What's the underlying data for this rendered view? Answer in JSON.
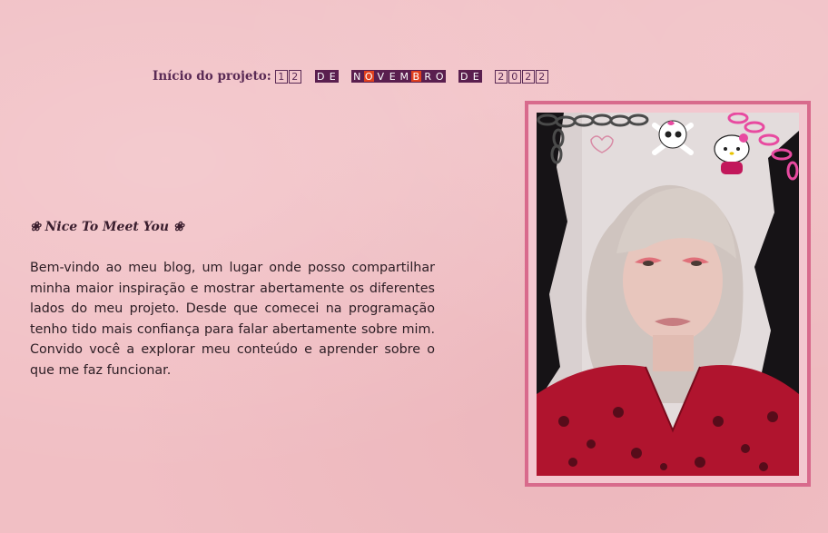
{
  "project_start": {
    "label": "Início do projeto:",
    "day": [
      "1",
      "2"
    ],
    "de1": [
      "D",
      "E"
    ],
    "month": [
      {
        "ch": "N",
        "style": "dark"
      },
      {
        "ch": "O",
        "style": "red"
      },
      {
        "ch": "V",
        "style": "dark"
      },
      {
        "ch": "E",
        "style": "dark"
      },
      {
        "ch": "M",
        "style": "dark"
      },
      {
        "ch": "B",
        "style": "red"
      },
      {
        "ch": "R",
        "style": "dark"
      },
      {
        "ch": "O",
        "style": "dark"
      }
    ],
    "de2": [
      "D",
      "E"
    ],
    "year": [
      "2",
      "0",
      "2",
      "2"
    ]
  },
  "intro": {
    "heading": "❀ Nice To Meet You ❀",
    "text": "Bem-vindo ao meu blog, um lugar onde posso compartilhar minha maior inspiração e mostrar abertamente os diferentes lados do meu projeto. Desde que comecei na programação tenho tido mais confiança para falar abertamente sobre mim. Convido você a explorar meu conteúdo e aprender sobre o que me faz funcionar."
  },
  "colors": {
    "background": "#f1bfc4",
    "frame": "#d86a8c",
    "tile_dark": "#5a1f4f",
    "tile_red": "#e0401e"
  }
}
